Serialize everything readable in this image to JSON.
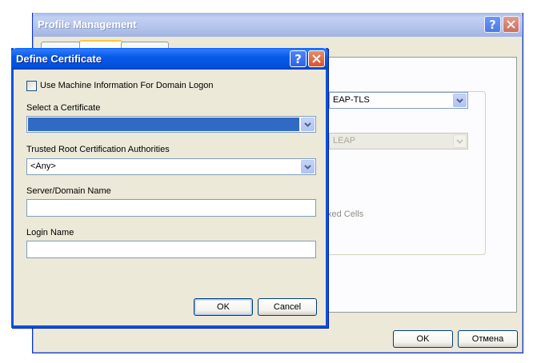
{
  "back_window": {
    "title": "Profile Management",
    "eap_value": "EAP-TLS",
    "leap_value": "LEAP",
    "mixed_cells_fragment": "xed Cells",
    "ok_label": "OK",
    "cancel_label": "Отмена"
  },
  "dialog": {
    "title": "Define Certificate",
    "use_machine_info_label": "Use Machine Information For Domain Logon",
    "use_machine_info_checked": false,
    "select_certificate_label": "Select a Certificate",
    "select_certificate_value": "",
    "trusted_root_label": "Trusted Root Certification Authorities",
    "trusted_root_value": "<Any>",
    "server_domain_label": "Server/Domain Name",
    "server_domain_value": "",
    "login_name_label": "Login Name",
    "login_name_value": "",
    "ok_label": "OK",
    "cancel_label": "Cancel"
  },
  "colors": {
    "title_active": "#0054e3",
    "selection": "#316ac5",
    "dialog_bg": "#ece9d8"
  }
}
